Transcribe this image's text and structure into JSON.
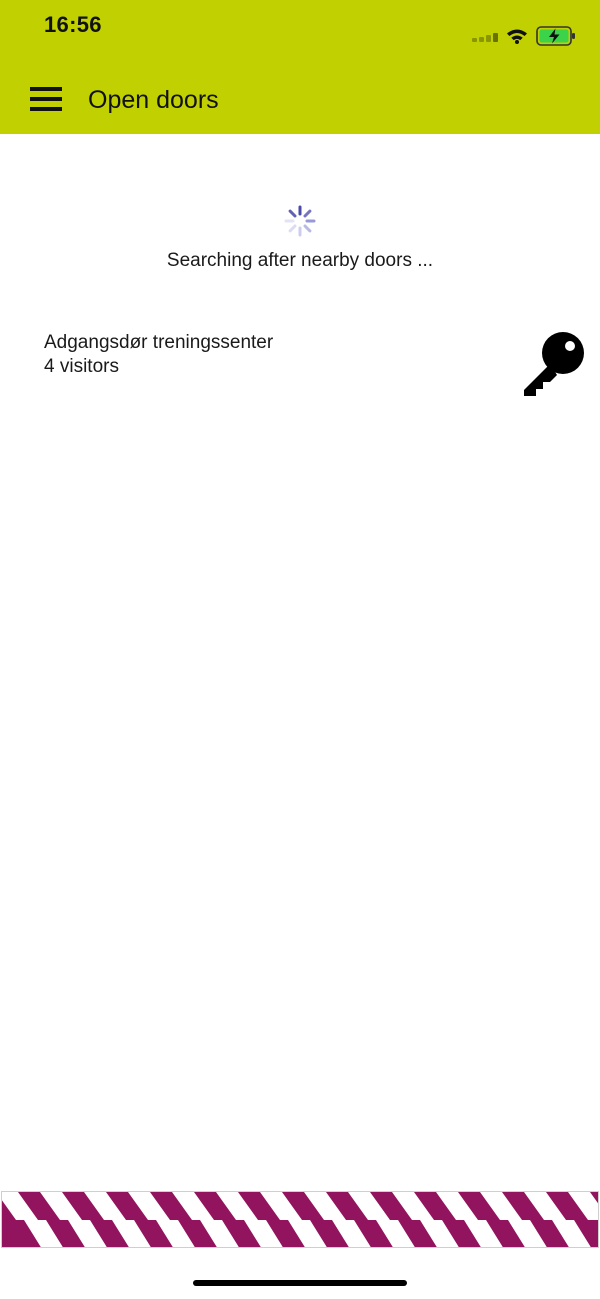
{
  "status_bar": {
    "time": "16:56",
    "icons": [
      "signal-icon",
      "wifi-icon",
      "battery-charging-icon"
    ]
  },
  "header": {
    "title": "Open doors",
    "menu_icon": "hamburger-menu-icon"
  },
  "search": {
    "status_text": "Searching after nearby doors ...",
    "spinner_icon": "loading-spinner-icon"
  },
  "doors": [
    {
      "name": "Adgangsdør treningssenter",
      "visitors": "4 visitors",
      "action_icon": "key-icon"
    }
  ],
  "colors": {
    "header_bg": "#c0d000",
    "footer_stripe": "#92135e",
    "spinner": "#6f6fc8",
    "battery": "#3bd34a"
  }
}
